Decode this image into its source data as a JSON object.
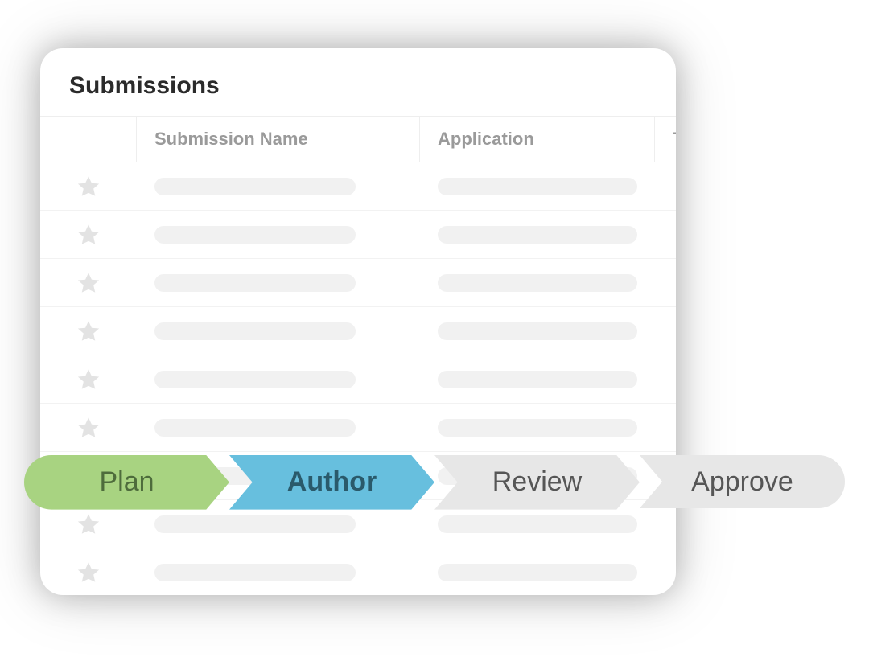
{
  "card": {
    "title": "Submissions",
    "columns": {
      "name": "Submission Name",
      "application": "Application",
      "type": "Type"
    },
    "row_count": 9
  },
  "stepper": {
    "steps": [
      {
        "label": "Plan",
        "color": "#a8d381",
        "active": false
      },
      {
        "label": "Author",
        "color": "#67bfde",
        "active": true
      },
      {
        "label": "Review",
        "color": "#e7e7e7",
        "active": false
      },
      {
        "label": "Approve",
        "color": "#e7e7e7",
        "active": false
      }
    ]
  }
}
